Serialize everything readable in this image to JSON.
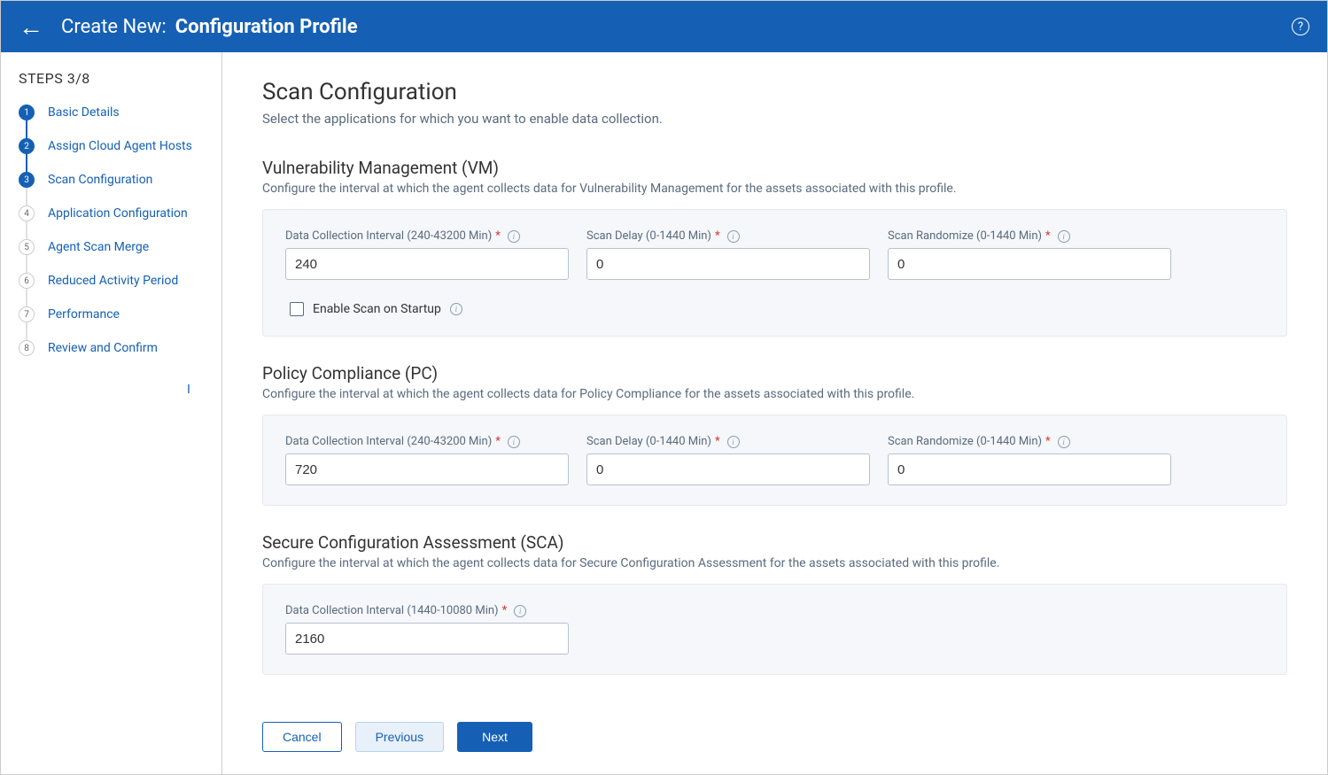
{
  "header": {
    "prefix": "Create New:",
    "title": "Configuration Profile"
  },
  "sidebar": {
    "steps_label": "STEPS 3/8",
    "steps": [
      {
        "num": "1",
        "label": "Basic Details",
        "state": "done"
      },
      {
        "num": "2",
        "label": "Assign Cloud Agent Hosts",
        "state": "done"
      },
      {
        "num": "3",
        "label": "Scan Configuration",
        "state": "current"
      },
      {
        "num": "4",
        "label": "Application Configuration",
        "state": "pending"
      },
      {
        "num": "5",
        "label": "Agent Scan Merge",
        "state": "pending"
      },
      {
        "num": "6",
        "label": "Reduced Activity Period",
        "state": "pending"
      },
      {
        "num": "7",
        "label": "Performance",
        "state": "pending"
      },
      {
        "num": "8",
        "label": "Review and Confirm",
        "state": "pending"
      }
    ]
  },
  "main": {
    "title": "Scan Configuration",
    "subtitle": "Select the applications for which you want to enable data collection.",
    "sections": {
      "vm": {
        "title": "Vulnerability Management (VM)",
        "subtitle": "Configure the interval at which the agent collects data for Vulnerability Management for the assets associated with this profile.",
        "fields": {
          "interval": {
            "label": "Data Collection Interval (240-43200 Min)",
            "value": "240"
          },
          "delay": {
            "label": "Scan Delay (0-1440 Min)",
            "value": "0"
          },
          "randomize": {
            "label": "Scan Randomize (0-1440 Min)",
            "value": "0"
          }
        },
        "checkbox_label": "Enable Scan on Startup"
      },
      "pc": {
        "title": "Policy Compliance (PC)",
        "subtitle": "Configure the interval at which the agent collects data for Policy Compliance for the assets associated with this profile.",
        "fields": {
          "interval": {
            "label": "Data Collection Interval (240-43200 Min)",
            "value": "720"
          },
          "delay": {
            "label": "Scan Delay (0-1440 Min)",
            "value": "0"
          },
          "randomize": {
            "label": "Scan Randomize (0-1440 Min)",
            "value": "0"
          }
        }
      },
      "sca": {
        "title": "Secure Configuration Assessment (SCA)",
        "subtitle": "Configure the interval at which the agent collects data for Secure Configuration Assessment for the assets associated with this profile.",
        "fields": {
          "interval": {
            "label": "Data Collection Interval (1440-10080 Min)",
            "value": "2160"
          }
        }
      }
    }
  },
  "footer": {
    "cancel": "Cancel",
    "previous": "Previous",
    "next": "Next"
  }
}
